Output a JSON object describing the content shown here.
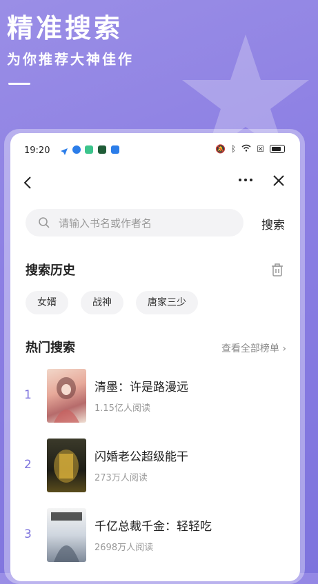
{
  "hero": {
    "title": "精准搜索",
    "subtitle": "为你推荐大神佳作"
  },
  "status_bar": {
    "time": "19:20"
  },
  "search": {
    "placeholder": "请输入书名或作者名",
    "button_label": "搜索"
  },
  "history": {
    "title": "搜索历史",
    "tags": [
      "女婿",
      "战神",
      "唐家三少"
    ]
  },
  "hot": {
    "title": "热门搜索",
    "view_all": "查看全部榜单 ›",
    "items": [
      {
        "rank": "1",
        "title": "清墨：许是路漫远",
        "reads": "1.15亿人阅读"
      },
      {
        "rank": "2",
        "title": "闪婚老公超级能干",
        "reads": "273万人阅读"
      },
      {
        "rank": "3",
        "title": "千亿总裁千金：轻轻吃",
        "reads": "2698万人阅读"
      }
    ]
  },
  "colors": {
    "accent": "#7d73dd",
    "background": "#8c7fe3"
  },
  "icons": {
    "back": "chevron-left-icon",
    "more": "more-dots-icon",
    "close": "close-icon",
    "search": "search-icon",
    "trash": "trash-icon"
  }
}
